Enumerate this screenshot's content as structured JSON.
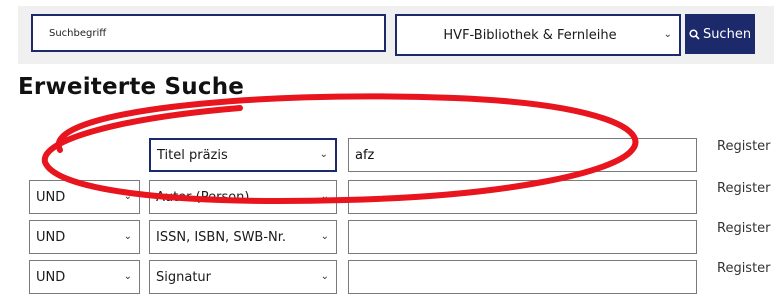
{
  "header": {
    "search_placeholder": "Suchbegriff",
    "scope_selected": "HVF-Bibliothek & Fernleihe",
    "search_button_label": "Suchen"
  },
  "page": {
    "title": "Erweiterte Suche"
  },
  "search_rows": [
    {
      "operator": "",
      "field": "Titel präzis",
      "term": "afz",
      "register_label": "Register"
    },
    {
      "operator": "UND",
      "field": "Autor (Person)",
      "term": "",
      "register_label": "Register"
    },
    {
      "operator": "UND",
      "field": "ISSN, ISBN, SWB-Nr.",
      "term": "",
      "register_label": "Register"
    },
    {
      "operator": "UND",
      "field": "Signatur",
      "term": "",
      "register_label": "Register"
    }
  ],
  "colors": {
    "accent": "#1c2a6b",
    "annotation": "#e8141e",
    "topbar_bg": "#f0f0f0"
  }
}
